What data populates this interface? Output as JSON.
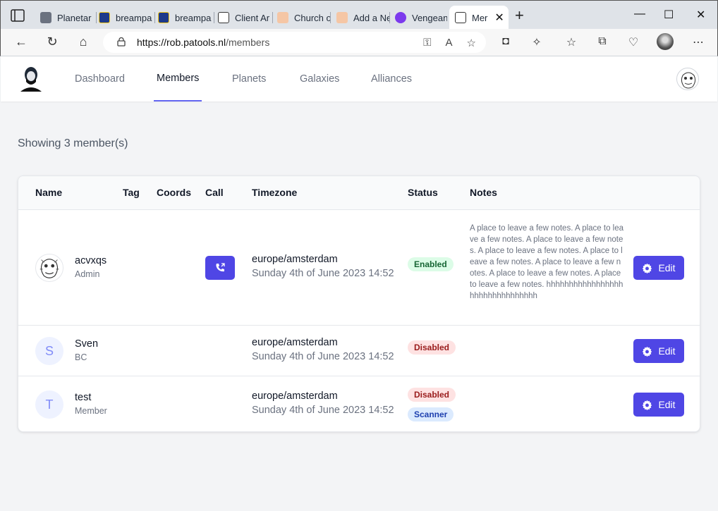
{
  "browser": {
    "tabs": [
      {
        "label": "Planetar",
        "fav_color": "#6b7280"
      },
      {
        "label": "breampa",
        "fav_color": "#1e3a8a"
      },
      {
        "label": "breampa",
        "fav_color": "#1e3a8a"
      },
      {
        "label": "Client Ar",
        "fav_color": "#ffffff"
      },
      {
        "label": "Church o",
        "fav_color": "#f59e0b"
      },
      {
        "label": "Add a Ne",
        "fav_color": "#f59e0b"
      },
      {
        "label": "Vengean",
        "fav_color": "#7c3aed"
      }
    ],
    "active_tab": {
      "label": "Mer"
    },
    "url_host": "https://rob.patools.nl",
    "url_path": "/members"
  },
  "nav": {
    "links": [
      "Dashboard",
      "Members",
      "Planets",
      "Galaxies",
      "Alliances"
    ],
    "active": "Members"
  },
  "page": {
    "showing_text": "Showing 3 member(s)"
  },
  "table": {
    "headers": {
      "name": "Name",
      "tag": "Tag",
      "coords": "Coords",
      "call": "Call",
      "timezone": "Timezone",
      "status": "Status",
      "notes": "Notes"
    },
    "rows": [
      {
        "name": "acvxqs",
        "role": "Admin",
        "initial": "",
        "timezone": "europe/amsterdam",
        "time": "Sunday 4th of June 2023 14:52",
        "status": "Enabled",
        "notes": "A place to leave a few notes. A place to leave a few notes. A place to leave a few notes. A place to leave a few notes. A place to leave a few notes. A place to leave a few notes. A place to leave a few notes. A place to leave a few notes. hhhhhhhhhhhhhhhhhhhhhhhhhhhhhhhh",
        "edit": "Edit"
      },
      {
        "name": "Sven",
        "role": "BC",
        "initial": "S",
        "timezone": "europe/amsterdam",
        "time": "Sunday 4th of June 2023 14:52",
        "status": "Disabled",
        "edit": "Edit"
      },
      {
        "name": "test",
        "role": "Member",
        "initial": "T",
        "timezone": "europe/amsterdam",
        "time": "Sunday 4th of June 2023 14:52",
        "status": "Disabled",
        "extra_badge": "Scanner",
        "edit": "Edit"
      }
    ]
  },
  "colors": {
    "accent": "#4f46e5",
    "active_underline": "#6366f1"
  }
}
